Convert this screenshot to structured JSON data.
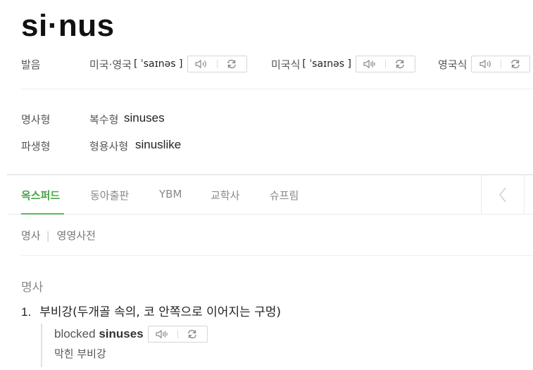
{
  "entry": {
    "headword": "si·nus"
  },
  "pronunciation": {
    "label": "발음",
    "items": [
      {
        "region": "미국·영국",
        "ipa": "[ ˈsaɪnəs ]"
      },
      {
        "region": "미국식",
        "ipa": "[ ˈsaɪnəs ]"
      },
      {
        "region": "영국식",
        "ipa": ""
      }
    ]
  },
  "forms": [
    {
      "label": "명사형",
      "kind": "복수형",
      "word": "sinuses"
    },
    {
      "label": "파생형",
      "kind": "형용사형",
      "word": "sinuslike"
    }
  ],
  "tabs": [
    "옥스퍼드",
    "동아출판",
    "YBM",
    "교학사",
    "슈프림"
  ],
  "subnav": {
    "pos": "명사",
    "dict": "영영사전"
  },
  "definition": {
    "pos": "명사",
    "number": "1.",
    "meaning": "부비강(두개골 속의, 코 안쪽으로 이어지는 구멍)",
    "example": {
      "prefix": "blocked",
      "highlight": "sinuses",
      "translation": "막힌 부비강"
    }
  },
  "icons": {
    "speaker": "speaker-icon",
    "repeat": "repeat-icon",
    "prev": "chevron-left-icon"
  },
  "colors": {
    "active_tab": "#4aa44a"
  }
}
